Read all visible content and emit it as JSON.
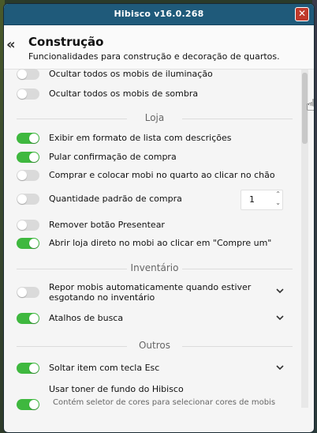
{
  "window": {
    "title": "Hibisco v16.0.268",
    "close_glyph": "✕"
  },
  "header": {
    "back_glyph": "«",
    "title": "Construção",
    "subtitle": "Funcionalidades para construção e decoração de quartos."
  },
  "settings": {
    "ocultar_iluminacao": {
      "label": "Ocultar todos os mobis de iluminação",
      "enabled": false
    },
    "ocultar_sombra": {
      "label": "Ocultar todos os mobis de sombra",
      "enabled": false
    }
  },
  "sections": {
    "loja": "Loja",
    "inventario": "Inventário",
    "outros": "Outros"
  },
  "loja": {
    "lista": {
      "label": "Exibir em formato de lista com descrições",
      "enabled": true
    },
    "pular": {
      "label": "Pular confirmação de compra",
      "enabled": true
    },
    "comprar_colocar": {
      "label": "Comprar e colocar mobi no quarto ao clicar no chão",
      "enabled": false
    },
    "quantidade": {
      "label": "Quantidade padrão de compra",
      "enabled": false,
      "value": "1"
    },
    "presentear": {
      "label": "Remover botão Presentear",
      "enabled": false
    },
    "abrir_loja": {
      "label": "Abrir loja direto no mobi ao clicar em \"Compre um\"",
      "enabled": true
    }
  },
  "inventario": {
    "repor": {
      "label": "Repor mobis automaticamente quando estiver esgotando no inventário",
      "enabled": false
    },
    "atalhos": {
      "label": "Atalhos de busca",
      "enabled": true
    }
  },
  "outros": {
    "soltar": {
      "label": "Soltar item com tecla Esc",
      "enabled": true
    },
    "toner": {
      "label": "Usar toner de fundo do Hibisco",
      "sublabel": "Contém seletor de cores para selecionar cores de mobis",
      "enabled": true
    }
  },
  "icons": {
    "close": "close-icon",
    "back": "double-chevron-left-icon",
    "expand": "chevron-down-icon"
  },
  "colors": {
    "titlebar": "#1f5a7a",
    "toggle_on": "#3fb83f",
    "toggle_off": "#dadada",
    "close": "#c0392b"
  }
}
